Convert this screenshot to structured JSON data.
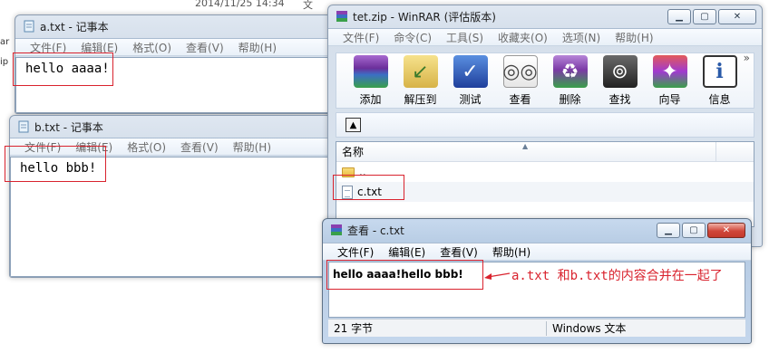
{
  "background": {
    "date": "2014/11/25 14:34",
    "extra": "文",
    "left_labels": [
      "ar",
      "ip"
    ]
  },
  "notepad_a": {
    "title": "a.txt - 记事本",
    "menu": [
      "文件(F)",
      "编辑(E)",
      "格式(O)",
      "查看(V)",
      "帮助(H)"
    ],
    "content": "hello aaaa!"
  },
  "notepad_b": {
    "title": "b.txt - 记事本",
    "menu": [
      "文件(F)",
      "编辑(E)",
      "格式(O)",
      "查看(V)",
      "帮助(H)"
    ],
    "content": "hello bbb!"
  },
  "winrar": {
    "title": "tet.zip - WinRAR (评估版本)",
    "menu": [
      "文件(F)",
      "命令(C)",
      "工具(S)",
      "收藏夹(O)",
      "选项(N)",
      "帮助(H)"
    ],
    "toolbar": [
      "添加",
      "解压到",
      "测试",
      "查看",
      "删除",
      "查找",
      "向导",
      "信息"
    ],
    "column_name": "名称",
    "rows": [
      "..",
      "c.txt"
    ]
  },
  "viewer": {
    "title": "查看 - c.txt",
    "menu": [
      "文件(F)",
      "编辑(E)",
      "查看(V)",
      "帮助(H)"
    ],
    "content": "hello aaaa!hello bbb!",
    "status_size": "21 字节",
    "status_encoding": "Windows 文本"
  },
  "annotation": "a.txt 和b.txt的内容合并在一起了",
  "colors": {
    "highlight_red": "#d9232e",
    "frame_blue": "#b6cbe3"
  }
}
